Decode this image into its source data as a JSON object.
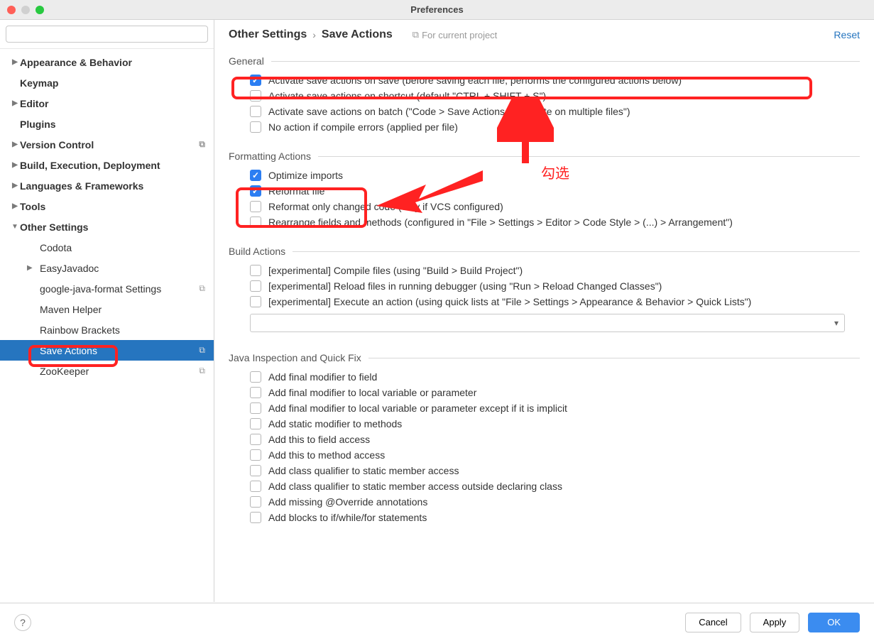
{
  "window_title": "Preferences",
  "search": {
    "placeholder": ""
  },
  "sidebar": {
    "items": [
      {
        "label": "Appearance & Behavior",
        "bold": true,
        "arrow": "▶"
      },
      {
        "label": "Keymap",
        "bold": true,
        "arrow": ""
      },
      {
        "label": "Editor",
        "bold": true,
        "arrow": "▶"
      },
      {
        "label": "Plugins",
        "bold": true,
        "arrow": ""
      },
      {
        "label": "Version Control",
        "bold": true,
        "arrow": "▶",
        "project": true
      },
      {
        "label": "Build, Execution, Deployment",
        "bold": true,
        "arrow": "▶"
      },
      {
        "label": "Languages & Frameworks",
        "bold": true,
        "arrow": "▶"
      },
      {
        "label": "Tools",
        "bold": true,
        "arrow": "▶"
      },
      {
        "label": "Other Settings",
        "bold": true,
        "arrow": "▼"
      }
    ],
    "subitems": [
      {
        "label": "Codota"
      },
      {
        "label": "EasyJavadoc",
        "arrow": "▶"
      },
      {
        "label": "google-java-format Settings",
        "project": true
      },
      {
        "label": "Maven Helper"
      },
      {
        "label": "Rainbow Brackets"
      },
      {
        "label": "Save Actions",
        "selected": true,
        "project": true
      },
      {
        "label": "ZooKeeper",
        "project": true
      }
    ]
  },
  "breadcrumb": {
    "parent": "Other Settings",
    "current": "Save Actions",
    "for_project": "For current project",
    "reset": "Reset"
  },
  "sections": {
    "general": {
      "title": "General",
      "items": [
        {
          "label": "Activate save actions on save (before saving each file, performs the configured actions below)",
          "checked": true
        },
        {
          "label": "Activate save actions on shortcut (default \"CTRL + SHIFT + S\")",
          "checked": false
        },
        {
          "label": "Activate save actions on batch (\"Code > Save Actions > Execute on multiple files\")",
          "checked": false
        },
        {
          "label": "No action if compile errors (applied per file)",
          "checked": false
        }
      ]
    },
    "formatting": {
      "title": "Formatting Actions",
      "items": [
        {
          "label": "Optimize imports",
          "checked": true
        },
        {
          "label": "Reformat file",
          "checked": true
        },
        {
          "label": "Reformat only changed code (only if VCS configured)",
          "checked": false
        },
        {
          "label": "Rearrange fields and methods (configured in \"File > Settings > Editor > Code Style > (...) > Arrangement\")",
          "checked": false
        }
      ]
    },
    "build": {
      "title": "Build Actions",
      "items": [
        {
          "label": "[experimental] Compile files (using \"Build > Build Project\")",
          "checked": false
        },
        {
          "label": "[experimental] Reload files in running debugger (using \"Run > Reload Changed Classes\")",
          "checked": false
        },
        {
          "label": "[experimental] Execute an action (using quick lists at \"File > Settings > Appearance & Behavior > Quick Lists\")",
          "checked": false
        }
      ]
    },
    "inspection": {
      "title": "Java Inspection and Quick Fix",
      "items": [
        {
          "label": "Add final modifier to field",
          "checked": false
        },
        {
          "label": "Add final modifier to local variable or parameter",
          "checked": false
        },
        {
          "label": "Add final modifier to local variable or parameter except if it is implicit",
          "checked": false
        },
        {
          "label": "Add static modifier to methods",
          "checked": false
        },
        {
          "label": "Add this to field access",
          "checked": false
        },
        {
          "label": "Add this to method access",
          "checked": false
        },
        {
          "label": "Add class qualifier to static member access",
          "checked": false
        },
        {
          "label": "Add class qualifier to static member access outside declaring class",
          "checked": false
        },
        {
          "label": "Add missing @Override annotations",
          "checked": false
        },
        {
          "label": "Add blocks to if/while/for statements",
          "checked": false
        }
      ]
    }
  },
  "footer": {
    "cancel": "Cancel",
    "apply": "Apply",
    "ok": "OK"
  },
  "annotation": {
    "text": "勾选"
  }
}
